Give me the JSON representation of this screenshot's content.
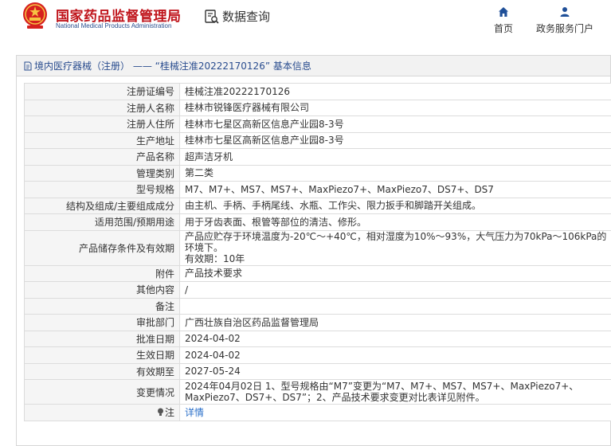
{
  "header": {
    "site_name_cn": "国家药品监督管理局",
    "site_name_en": "National Medical Products Administration",
    "query_label": "数据查询",
    "nav": {
      "home": "首页",
      "portal": "政务服务门户"
    }
  },
  "panel": {
    "title": "境内医疗器械（注册） ——  “桂械注准20222170126” 基本信息"
  },
  "rows": [
    {
      "label": "注册证编号",
      "value": "桂械注准20222170126"
    },
    {
      "label": "注册人名称",
      "value": "桂林市锐锋医疗器械有限公司"
    },
    {
      "label": "注册人住所",
      "value": "桂林市七星区高新区信息产业园8-3号"
    },
    {
      "label": "生产地址",
      "value": "桂林市七星区高新区信息产业园8-3号"
    },
    {
      "label": "产品名称",
      "value": "超声洁牙机"
    },
    {
      "label": "管理类别",
      "value": "第二类"
    },
    {
      "label": "型号规格",
      "value": "M7、M7+、MS7、MS7+、MaxPiezo7+、MaxPiezo7、DS7+、DS7"
    },
    {
      "label": "结构及组成/主要组成成分",
      "value": "由主机、手柄、手柄尾线、水瓶、工作尖、限力扳手和脚踏开关组成。"
    },
    {
      "label": "适用范围/预期用途",
      "value": "用于牙齿表面、根管等部位的清洁、修形。"
    },
    {
      "label": "产品储存条件及有效期",
      "value": "产品应贮存于环境温度为-20℃～+40℃，相对湿度为10%～93%，大气压力为70kPa～106kPa的环境下。",
      "value2": "有效期：10年"
    },
    {
      "label": "附件",
      "value": "产品技术要求"
    },
    {
      "label": "其他内容",
      "value": "/"
    },
    {
      "label": "备注",
      "value": ""
    },
    {
      "label": "审批部门",
      "value": "广西壮族自治区药品监督管理局"
    },
    {
      "label": "批准日期",
      "value": "2024-04-02"
    },
    {
      "label": "生效日期",
      "value": "2024-04-02"
    },
    {
      "label": "有效期至",
      "value": "2027-05-24"
    },
    {
      "label": "变更情况",
      "value": "2024年04月02日 1、型号规格由“M7”变更为“M7、M7+、MS7、MS7+、MaxPiezo7+、MaxPiezo7、DS7+、DS7”；2、产品技术要求变更对比表详见附件。"
    },
    {
      "label": "注",
      "value": "详情"
    }
  ],
  "colors": {
    "brand_red": "#c0161d",
    "brand_blue": "#2b4f8f",
    "link_blue": "#2a6fc9",
    "label_bg": "#f5f5f5"
  }
}
